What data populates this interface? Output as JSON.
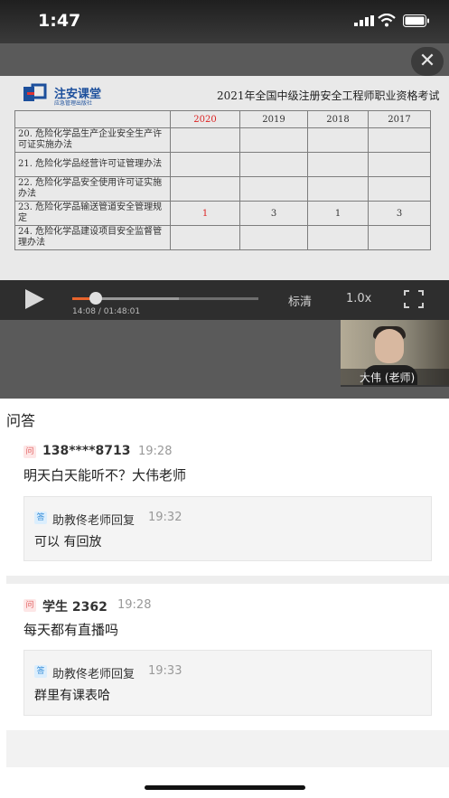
{
  "status_bar": {
    "time": "1:47"
  },
  "slide": {
    "logo_text": "注安课堂",
    "logo_sub": "应急管理出版社",
    "title": "2021年全国中级注册安全工程师职业资格考试",
    "headers": [
      "",
      "2020",
      "2019",
      "2018",
      "2017"
    ],
    "rows": [
      {
        "item": "20. 危险化学品生产企业安全生产许可证实施办法",
        "v2020": "",
        "v2019": "",
        "v2018": "",
        "v2017": ""
      },
      {
        "item": "21. 危险化学品经营许可证管理办法",
        "v2020": "",
        "v2019": "",
        "v2018": "",
        "v2017": ""
      },
      {
        "item": "22. 危险化学品安全使用许可证实施办法",
        "v2020": "",
        "v2019": "",
        "v2018": "",
        "v2017": ""
      },
      {
        "item": "23. 危险化学品输送管道安全管理规定",
        "v2020": "1",
        "v2019": "3",
        "v2018": "1",
        "v2017": "3"
      },
      {
        "item": "24. 危险化学品建设项目安全监督管理办法",
        "v2020": "",
        "v2019": "",
        "v2018": "",
        "v2017": ""
      }
    ]
  },
  "player": {
    "progress_fraction": 0.1265,
    "elapsed_time_text": "14:08 / 01:48:01",
    "quality": "标清",
    "speed": "1.0x",
    "teacher_label": "大伟 (老师)"
  },
  "qa": {
    "title": "问答",
    "q_badge": "问",
    "a_badge": "答",
    "items": [
      {
        "user": "138****8713",
        "time": "19:28",
        "question": "明天白天能听不？大伟老师",
        "replier": "助教佟老师回复",
        "reply_time": "19:32",
        "reply": "可以 有回放"
      },
      {
        "user": "学生 2362",
        "time": "19:28",
        "question": "每天都有直播吗",
        "replier": "助教佟老师回复",
        "reply_time": "19:33",
        "reply": "群里有课表哈"
      }
    ]
  },
  "colors": {
    "accent": "#e8642c",
    "question_badge": "#e26060",
    "answer_badge": "#3a8fd8"
  }
}
